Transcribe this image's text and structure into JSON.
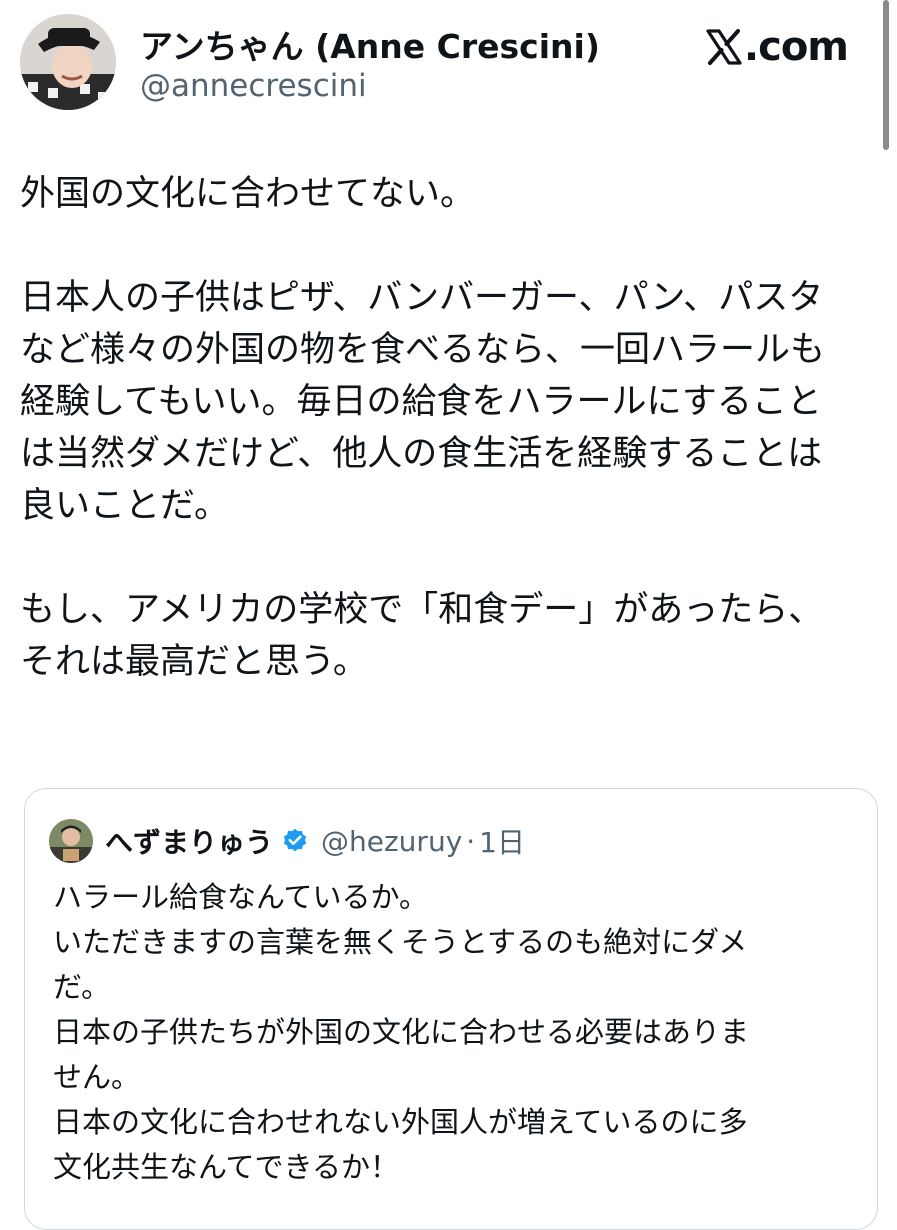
{
  "post": {
    "author": {
      "name": "アンちゃん (Anne Crescini)",
      "handle": "@annecrescini",
      "avatar_icon": "profile-photo-avatar"
    },
    "brand": {
      "icon": "x-logo-icon",
      "text": ".com"
    },
    "body_lines": [
      "外国の文化に合わせてない。",
      "",
      "日本人の子供はピザ、バンバーガー、パン、パスタ",
      "など様々の外国の物を食べるなら、一回ハラールも",
      "経験してもいい。毎日の給食をハラールにすること",
      "は当然ダメだけど、他人の食生活を経験することは",
      "良いことだ。",
      "",
      "もし、アメリカの学校で「和食デー」があったら、",
      "それは最高だと思う。"
    ]
  },
  "quote": {
    "author": {
      "name": "へずまりゅう",
      "verified_icon": "verified-badge-icon",
      "handle": "@hezuruy",
      "separator": "·",
      "time": "1日"
    },
    "body_lines": [
      "ハラール給食なんているか。",
      "いただきますの言葉を無くそうとするのも絶対にダメ",
      "だ。",
      "日本の子供たちが外国の文化に合わせる必要はありま",
      "せん。",
      "日本の文化に合わせれない外国人が増えているのに多",
      "文化共生なんてできるか！"
    ]
  },
  "colors": {
    "text_primary": "#0f1419",
    "text_secondary": "#536471",
    "border": "#cfd9de",
    "verified_blue": "#1d9bf0"
  }
}
